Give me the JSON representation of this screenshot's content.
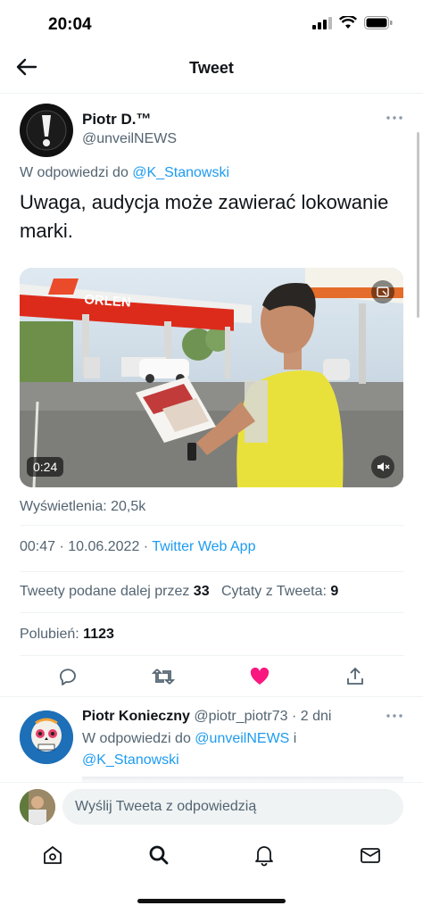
{
  "status_bar": {
    "time": "20:04"
  },
  "nav": {
    "title": "Tweet"
  },
  "tweet": {
    "author_name": "Piotr D.™",
    "author_handle": "@unveilNEWS",
    "reply_prefix": "W odpowiedzi do",
    "reply_to": "@K_Stanowski",
    "text": "Uwaga, audycja może zawierać lokowanie marki.",
    "media": {
      "duration": "0:24",
      "sign": "ORLEN"
    },
    "views_label": "Wyświetlenia: 20,5k",
    "timestamp": "00:47 · 10.06.2022 · ",
    "source": "Twitter Web App",
    "retweets_label": "Tweety podane dalej przez",
    "retweets_count": "33",
    "quotes_label": "Cytaty z Tweeta:",
    "quotes_count": "9",
    "likes_label": "Polubień:",
    "likes_count": "1123"
  },
  "reply": {
    "name": "Piotr Konieczny",
    "meta": "@piotr_piotr73 · 2 dni",
    "reply_prefix": "W odpowiedzi do",
    "to1": "@unveilNEWS",
    "conj": "i",
    "to2": "@K_Stanowski"
  },
  "compose": {
    "placeholder": "Wyślij Tweeta z odpowiedzią"
  },
  "colors": {
    "accent": "#1d9bf0",
    "like": "#f91880",
    "text_secondary": "#536471"
  }
}
